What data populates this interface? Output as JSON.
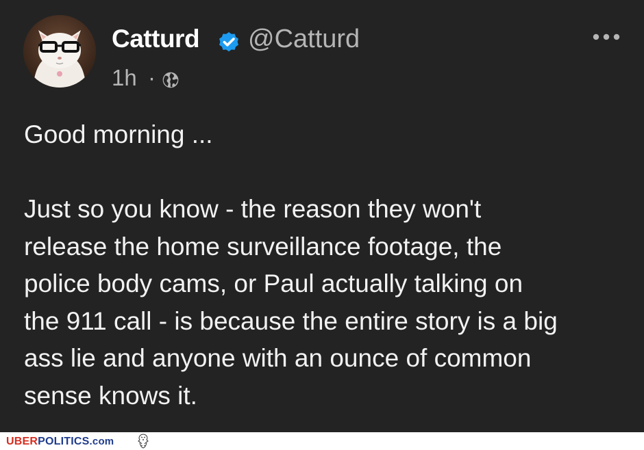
{
  "post": {
    "display_name": "Catturd",
    "handle": "@Catturd",
    "verified": true,
    "timestamp": "1h",
    "separator": "·",
    "visibility_icon": "globe-icon",
    "more_icon": "more-options-icon",
    "avatar_icon": "cat-with-glasses-avatar",
    "text_lines": [
      "Good morning ...",
      "",
      "Just so you know - the reason they won't",
      "release the home surveillance footage, the",
      "police body cams, or Paul actually talking on",
      "the 911 call - is because the entire story is a big",
      "ass lie and anyone with an ounce of common",
      "sense knows it."
    ]
  },
  "watermark": {
    "uber": "UBER",
    "politics": "POLITICS",
    "domain_suffix": ".com",
    "logo_icon": "eagle-icon"
  },
  "colors": {
    "background": "#232323",
    "text": "#f2f2f2",
    "muted": "#b5b5b5",
    "verified": "#1d9bf0",
    "brand_red": "#d62d20",
    "brand_blue": "#1f3c8c"
  }
}
